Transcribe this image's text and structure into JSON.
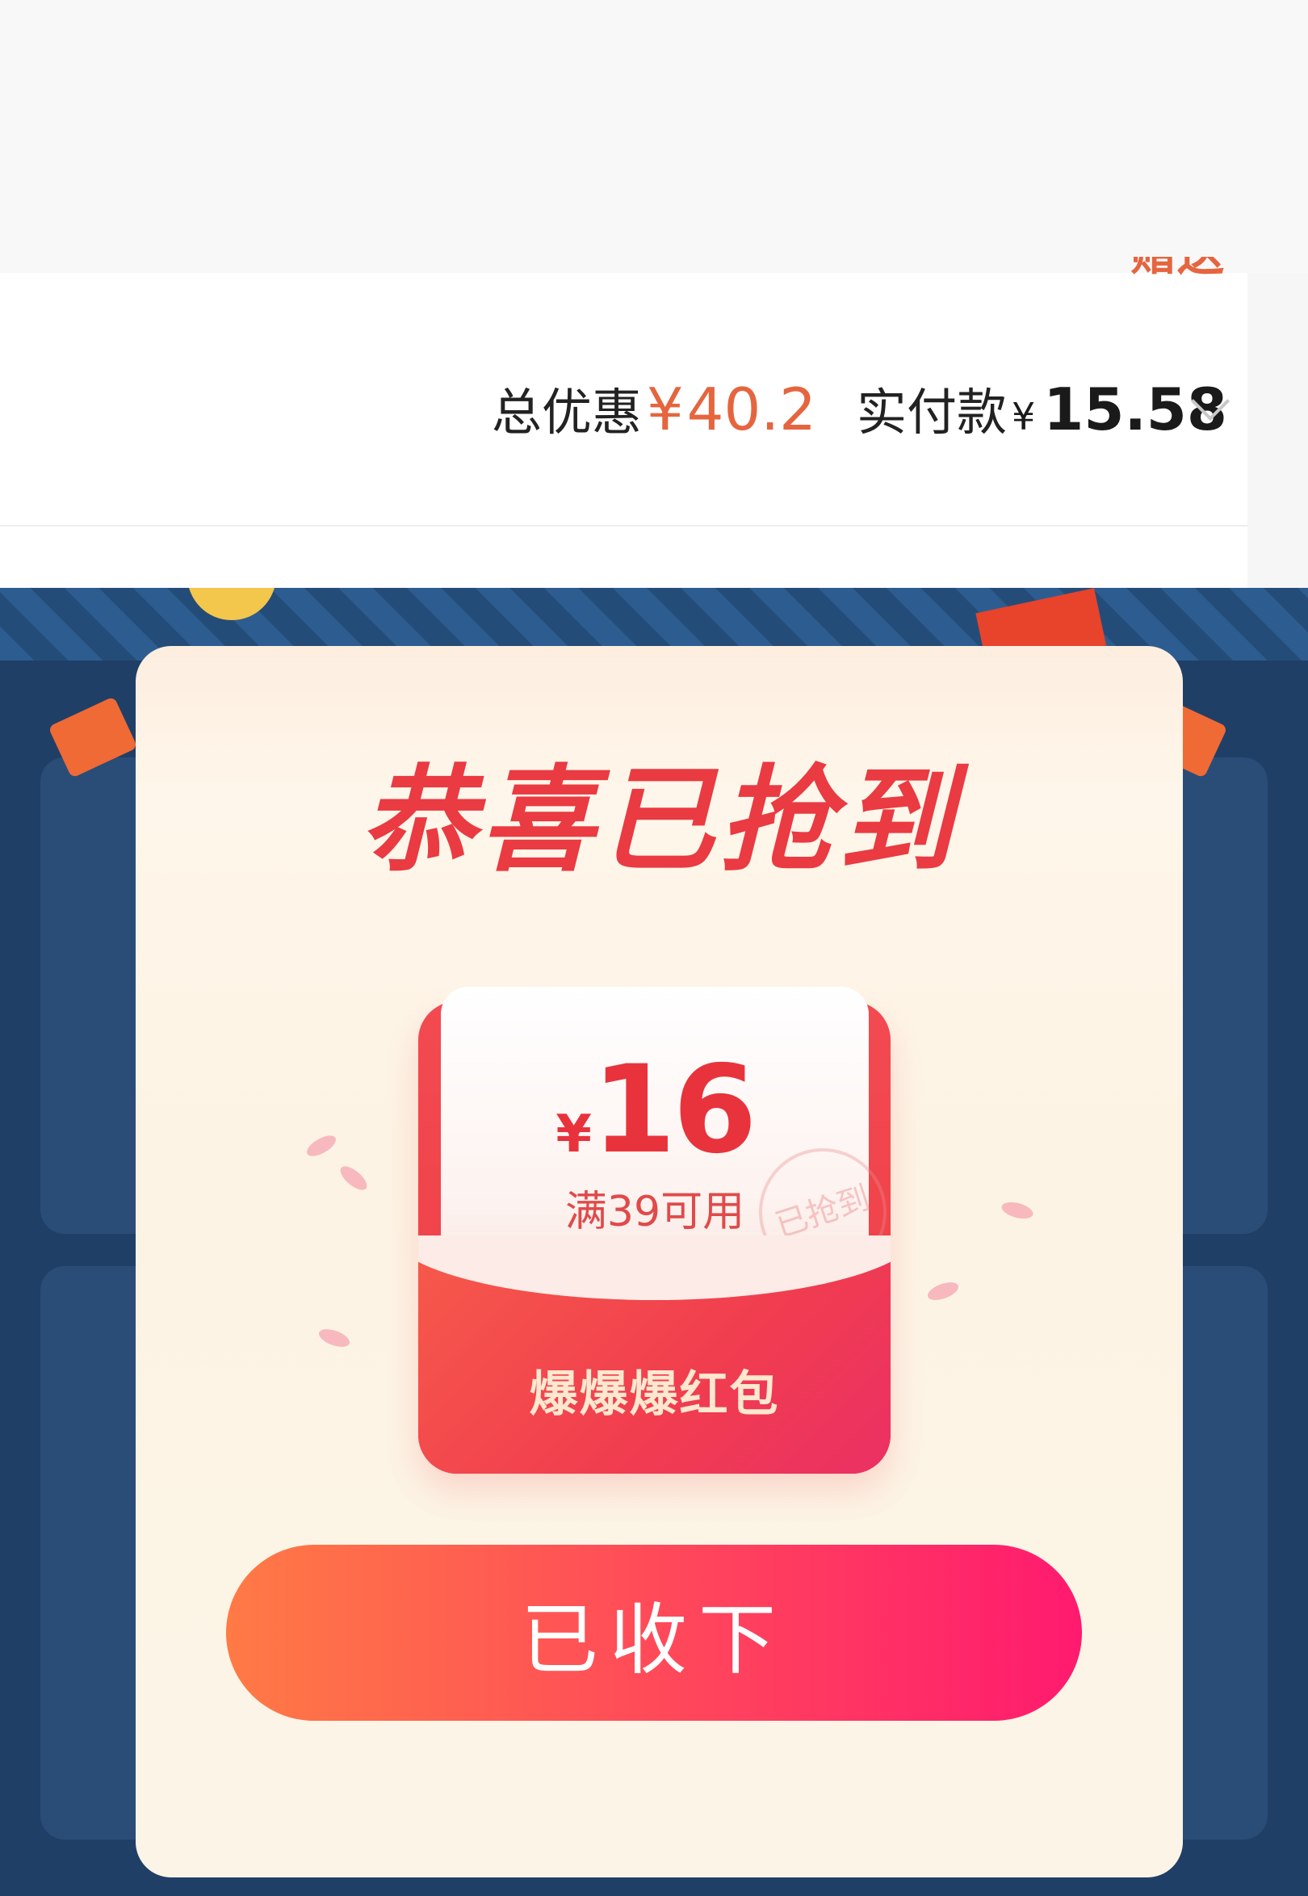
{
  "header": {
    "cut_label": "赠送"
  },
  "order_summary": {
    "discount_label": "总优惠",
    "discount_currency": "¥",
    "discount_value": "40.2",
    "paid_label": "实付款",
    "paid_currency": "¥",
    "paid_value": "15.58",
    "expand_icon": "chevron-down-icon"
  },
  "modal": {
    "title": "恭喜已抢到",
    "coupon": {
      "currency": "¥",
      "amount": "16",
      "condition": "满39可用",
      "stamp": "已抢到",
      "name": "爆爆爆红包"
    },
    "button_label": "已收下"
  },
  "colors": {
    "discount": "#e5653f",
    "title": "#ea3a42",
    "button_start": "#ff7a45",
    "button_end": "#ff1a6f",
    "background": "#203f66"
  }
}
